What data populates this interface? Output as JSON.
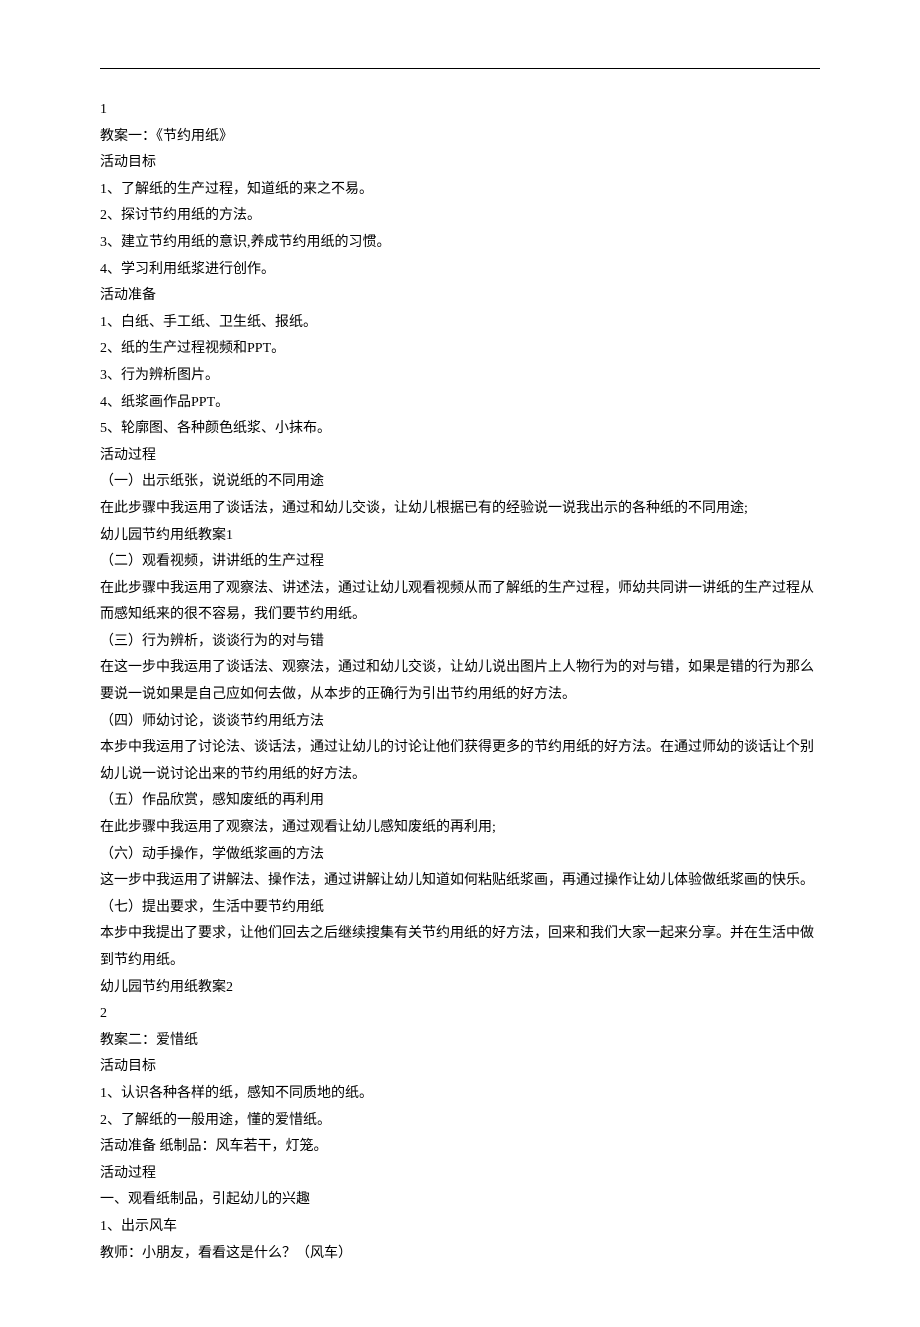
{
  "lines": [
    "1",
    "教案一：《节约用纸》",
    "活动目标",
    "1、了解纸的生产过程，知道纸的来之不易。",
    "2、探讨节约用纸的方法。",
    "3、建立节约用纸的意识,养成节约用纸的习惯。",
    "4、学习利用纸浆进行创作。",
    "活动准备",
    "1、白纸、手工纸、卫生纸、报纸。",
    "2、纸的生产过程视频和PPT。",
    "3、行为辨析图片。",
    "4、纸浆画作品PPT。",
    "5、轮廓图、各种颜色纸浆、小抹布。",
    "活动过程",
    "（一）出示纸张，说说纸的不同用途",
    "在此步骤中我运用了谈话法，通过和幼儿交谈，让幼儿根据已有的经验说一说我出示的各种纸的不同用途;",
    "幼儿园节约用纸教案1",
    "（二）观看视频，讲讲纸的生产过程",
    "在此步骤中我运用了观察法、讲述法，通过让幼儿观看视频从而了解纸的生产过程，师幼共同讲一讲纸的生产过程从而感知纸来的很不容易，我们要节约用纸。",
    "（三）行为辨析，谈谈行为的对与错",
    "在这一步中我运用了谈话法、观察法，通过和幼儿交谈，让幼儿说出图片上人物行为的对与错，如果是错的行为那么要说一说如果是自己应如何去做，从本步的正确行为引出节约用纸的好方法。",
    "（四）师幼讨论，谈谈节约用纸方法",
    "本步中我运用了讨论法、谈话法，通过让幼儿的讨论让他们获得更多的节约用纸的好方法。在通过师幼的谈话让个别幼儿说一说讨论出来的节约用纸的好方法。",
    "（五）作品欣赏，感知废纸的再利用",
    "在此步骤中我运用了观察法，通过观看让幼儿感知废纸的再利用;",
    "（六）动手操作，学做纸浆画的方法",
    "这一步中我运用了讲解法、操作法，通过讲解让幼儿知道如何粘贴纸浆画，再通过操作让幼儿体验做纸浆画的快乐。",
    "（七）提出要求，生活中要节约用纸",
    "本步中我提出了要求，让他们回去之后继续搜集有关节约用纸的好方法，回来和我们大家一起来分享。并在生活中做到节约用纸。",
    "幼儿园节约用纸教案2",
    "2",
    "教案二：爱惜纸",
    "活动目标",
    "1、认识各种各样的纸，感知不同质地的纸。",
    "2、了解纸的一般用途，懂的爱惜纸。",
    "活动准备 纸制品：风车若干，灯笼。",
    "活动过程",
    "一、观看纸制品，引起幼儿的兴趣",
    "1、出示风车",
    "教师：小朋友，看看这是什么？（风车）"
  ]
}
